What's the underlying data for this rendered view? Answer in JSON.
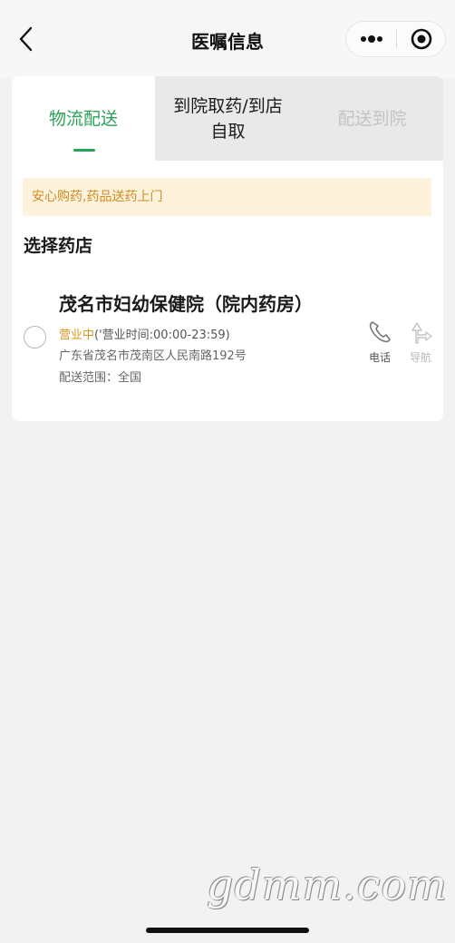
{
  "navbar": {
    "title": "医嘱信息",
    "back_icon": "chevron-left-icon",
    "more_icon": "more-dots-icon",
    "close_icon": "target-circle-icon"
  },
  "tabs": [
    {
      "label": "物流配送",
      "state": "active"
    },
    {
      "label": "到院取药/到店自取",
      "state": "normal"
    },
    {
      "label": "配送到院",
      "state": "disabled"
    }
  ],
  "notice": "安心购药,药品送药上门",
  "section_title": "选择药店",
  "store": {
    "name": "茂名市妇幼保健院（院内药房）",
    "status": "营业中",
    "hours": "('营业时间:00:00-23:59)",
    "address": "广东省茂名市茂南区人民南路192号",
    "range": "配送范围：全国",
    "selected": false,
    "actions": {
      "phone_label": "电话",
      "phone_icon": "phone-icon",
      "nav_label": "导航",
      "nav_icon": "navigation-icon"
    }
  },
  "watermark": "gdmm.com",
  "colors": {
    "accent": "#2aa357",
    "notice_bg": "#fdf3dd",
    "notice_text": "#d08a1e",
    "status_text": "#d99a18"
  }
}
